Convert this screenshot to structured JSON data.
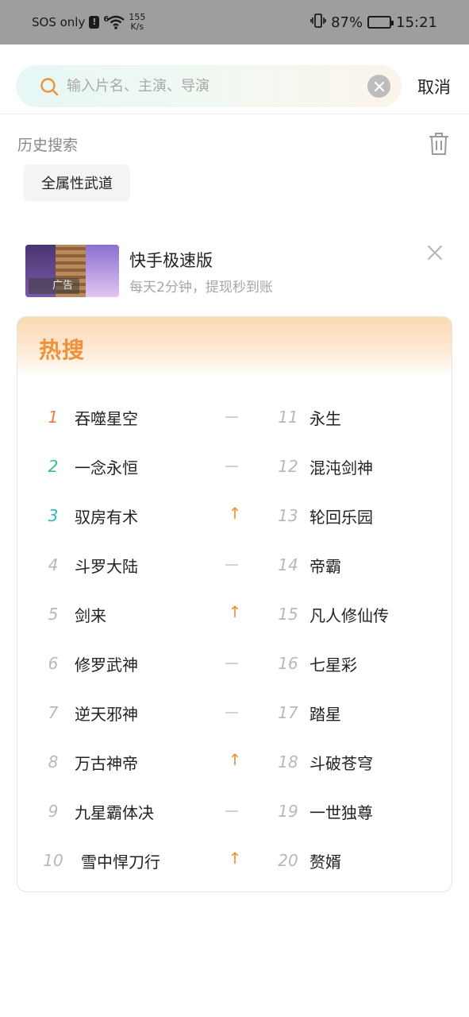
{
  "status_bar": {
    "carrier": "SOS only",
    "alert": "!",
    "signal": "6",
    "speed_value": "155",
    "speed_unit": "K/s",
    "battery_percent": "87%",
    "battery_level": 0.87,
    "time": "15:21"
  },
  "search": {
    "placeholder": "输入片名、主演、导演",
    "value": "",
    "cancel_label": "取消"
  },
  "history": {
    "title": "历史搜索",
    "items": [
      "全属性武道"
    ]
  },
  "ad": {
    "title": "快手极速版",
    "subtitle": "每天2分钟，提现秒到账",
    "tag": "广告"
  },
  "hot": {
    "title": "热搜",
    "trend_up_symbol": "↑",
    "left": [
      {
        "rank": "1",
        "title": "吞噬星空",
        "trend": "flat"
      },
      {
        "rank": "2",
        "title": "一念永恒",
        "trend": "flat"
      },
      {
        "rank": "3",
        "title": "驭房有术",
        "trend": "up"
      },
      {
        "rank": "4",
        "title": "斗罗大陆",
        "trend": "flat"
      },
      {
        "rank": "5",
        "title": "剑来",
        "trend": "up"
      },
      {
        "rank": "6",
        "title": "修罗武神",
        "trend": "flat"
      },
      {
        "rank": "7",
        "title": "逆天邪神",
        "trend": "flat"
      },
      {
        "rank": "8",
        "title": "万古神帝",
        "trend": "up"
      },
      {
        "rank": "9",
        "title": "九星霸体决",
        "trend": "flat"
      },
      {
        "rank": "10",
        "title": "雪中悍刀行",
        "trend": "up"
      }
    ],
    "right": [
      {
        "rank": "11",
        "title": "永生"
      },
      {
        "rank": "12",
        "title": "混沌剑神"
      },
      {
        "rank": "13",
        "title": "轮回乐园"
      },
      {
        "rank": "14",
        "title": "帝霸"
      },
      {
        "rank": "15",
        "title": "凡人修仙传"
      },
      {
        "rank": "16",
        "title": "七星彩"
      },
      {
        "rank": "17",
        "title": "踏星"
      },
      {
        "rank": "18",
        "title": "斗破苍穹"
      },
      {
        "rank": "19",
        "title": "一世独尊"
      },
      {
        "rank": "20",
        "title": "赘婿"
      }
    ]
  },
  "colors": {
    "accent_orange": "#f0923a",
    "rank1": "#f27a3a",
    "rank2": "#35c08f",
    "rank3": "#2fb6c9",
    "trend_up": "#f0923a"
  }
}
